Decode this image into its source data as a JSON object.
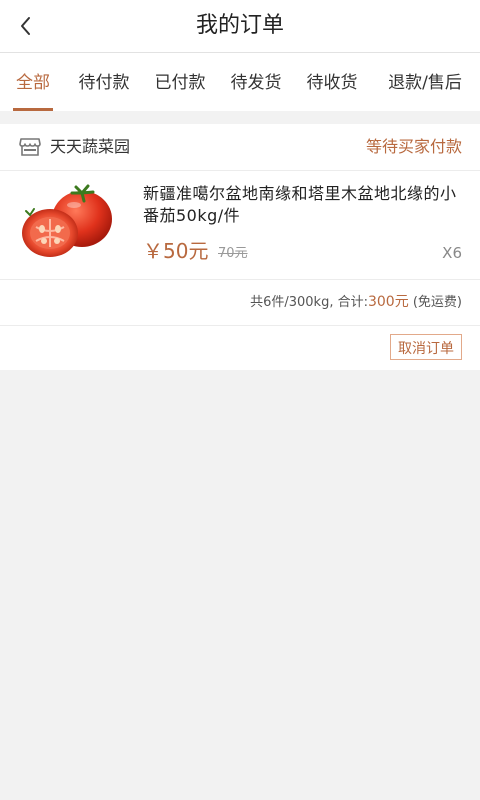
{
  "header": {
    "title": "我的订单",
    "back_icon": "chevron-left-icon"
  },
  "tabs": [
    {
      "label": "全部",
      "active": true
    },
    {
      "label": "待付款",
      "active": false
    },
    {
      "label": "已付款",
      "active": false
    },
    {
      "label": "待发货",
      "active": false
    },
    {
      "label": "待收货",
      "active": false
    },
    {
      "label": "退款/售后",
      "active": false
    }
  ],
  "order": {
    "shop": {
      "icon": "shop-icon",
      "name": "天天蔬菜园"
    },
    "status": "等待买家付款",
    "item": {
      "name": "新疆准噶尔盆地南缘和塔里木盆地北缘的小番茄50kg/件",
      "price": "￥50元",
      "original_price": "70元",
      "quantity": "X6",
      "thumb": "tomato-image"
    },
    "summary": {
      "prefix": "共6件/300kg, 合计:",
      "total": "300元",
      "suffix": "(免运费)"
    },
    "actions": {
      "cancel_label": "取消订单"
    }
  },
  "colors": {
    "accent": "#b8693f",
    "background": "#f2f2f2"
  }
}
